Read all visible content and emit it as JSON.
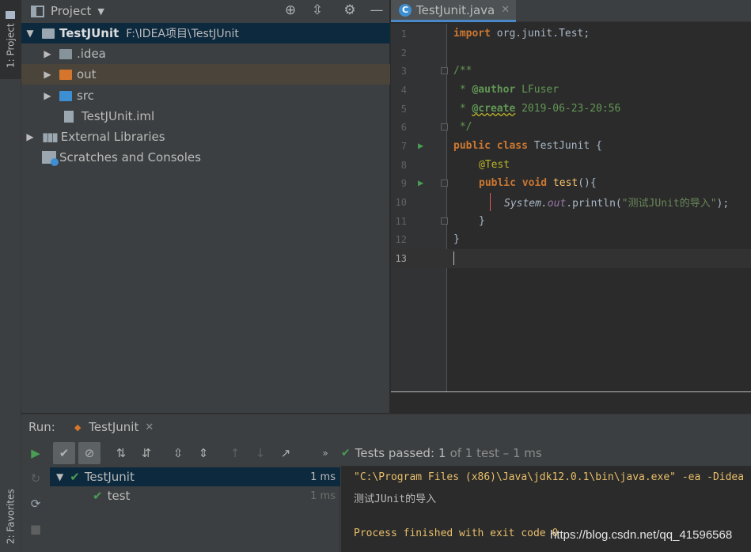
{
  "left_stripe": {
    "project_tab": "1: Project",
    "favorites_tab": "2: Favorites"
  },
  "project_panel": {
    "title": "Project",
    "tree": [
      {
        "label": "TestJUnit",
        "path": "F:\\IDEA项目\\TestJUnit"
      },
      {
        "label": ".idea"
      },
      {
        "label": "out"
      },
      {
        "label": "src"
      },
      {
        "label": "TestJUnit.iml"
      },
      {
        "label": "External Libraries"
      },
      {
        "label": "Scratches and Consoles"
      }
    ]
  },
  "editor": {
    "tab_label": "TestJunit.java",
    "lines": [
      {
        "n": "1"
      },
      {
        "n": "2"
      },
      {
        "n": "3"
      },
      {
        "n": "4"
      },
      {
        "n": "5"
      },
      {
        "n": "6"
      },
      {
        "n": "7"
      },
      {
        "n": "8"
      },
      {
        "n": "9"
      },
      {
        "n": "10"
      },
      {
        "n": "11"
      },
      {
        "n": "12"
      },
      {
        "n": "13"
      }
    ],
    "code": {
      "l1_kw": "import",
      "l1_rest": "org.junit.Test;",
      "l3": "/**",
      "l4_star": " * ",
      "l4_tag": "@author",
      "l4_val": " LFuser",
      "l5_star": " * ",
      "l5_tag": "@create",
      "l5_val": " 2019-06-23-20:56",
      "l6": " */",
      "l7_kw": "public class",
      "l7_name": "TestJunit {",
      "l8_ann": "@Test",
      "l9_kw": "public void",
      "l9_fn": "test",
      "l9_rest": "(){",
      "l10_cls": "System.",
      "l10_fld": "out",
      "l10_call": ".println(",
      "l10_str": "\"测试JUnit的导入\"",
      "l10_end": ");",
      "l11": "}",
      "l12": "}"
    }
  },
  "run_panel": {
    "label": "Run:",
    "tab_label": "TestJunit",
    "status_prefix": "Tests passed:",
    "status_count": "1",
    "status_suffix": "of 1 test – 1 ms",
    "tests": [
      {
        "name": "TestJunit",
        "time": "1 ms"
      },
      {
        "name": "test",
        "time": "1 ms"
      }
    ],
    "console": [
      "\"C:\\Program Files (x86)\\Java\\jdk12.0.1\\bin\\java.exe\" -ea -Didea",
      "测试JUnit的导入",
      "Process finished with exit code 0"
    ]
  },
  "watermark": "https://blog.csdn.net/qq_41596568"
}
